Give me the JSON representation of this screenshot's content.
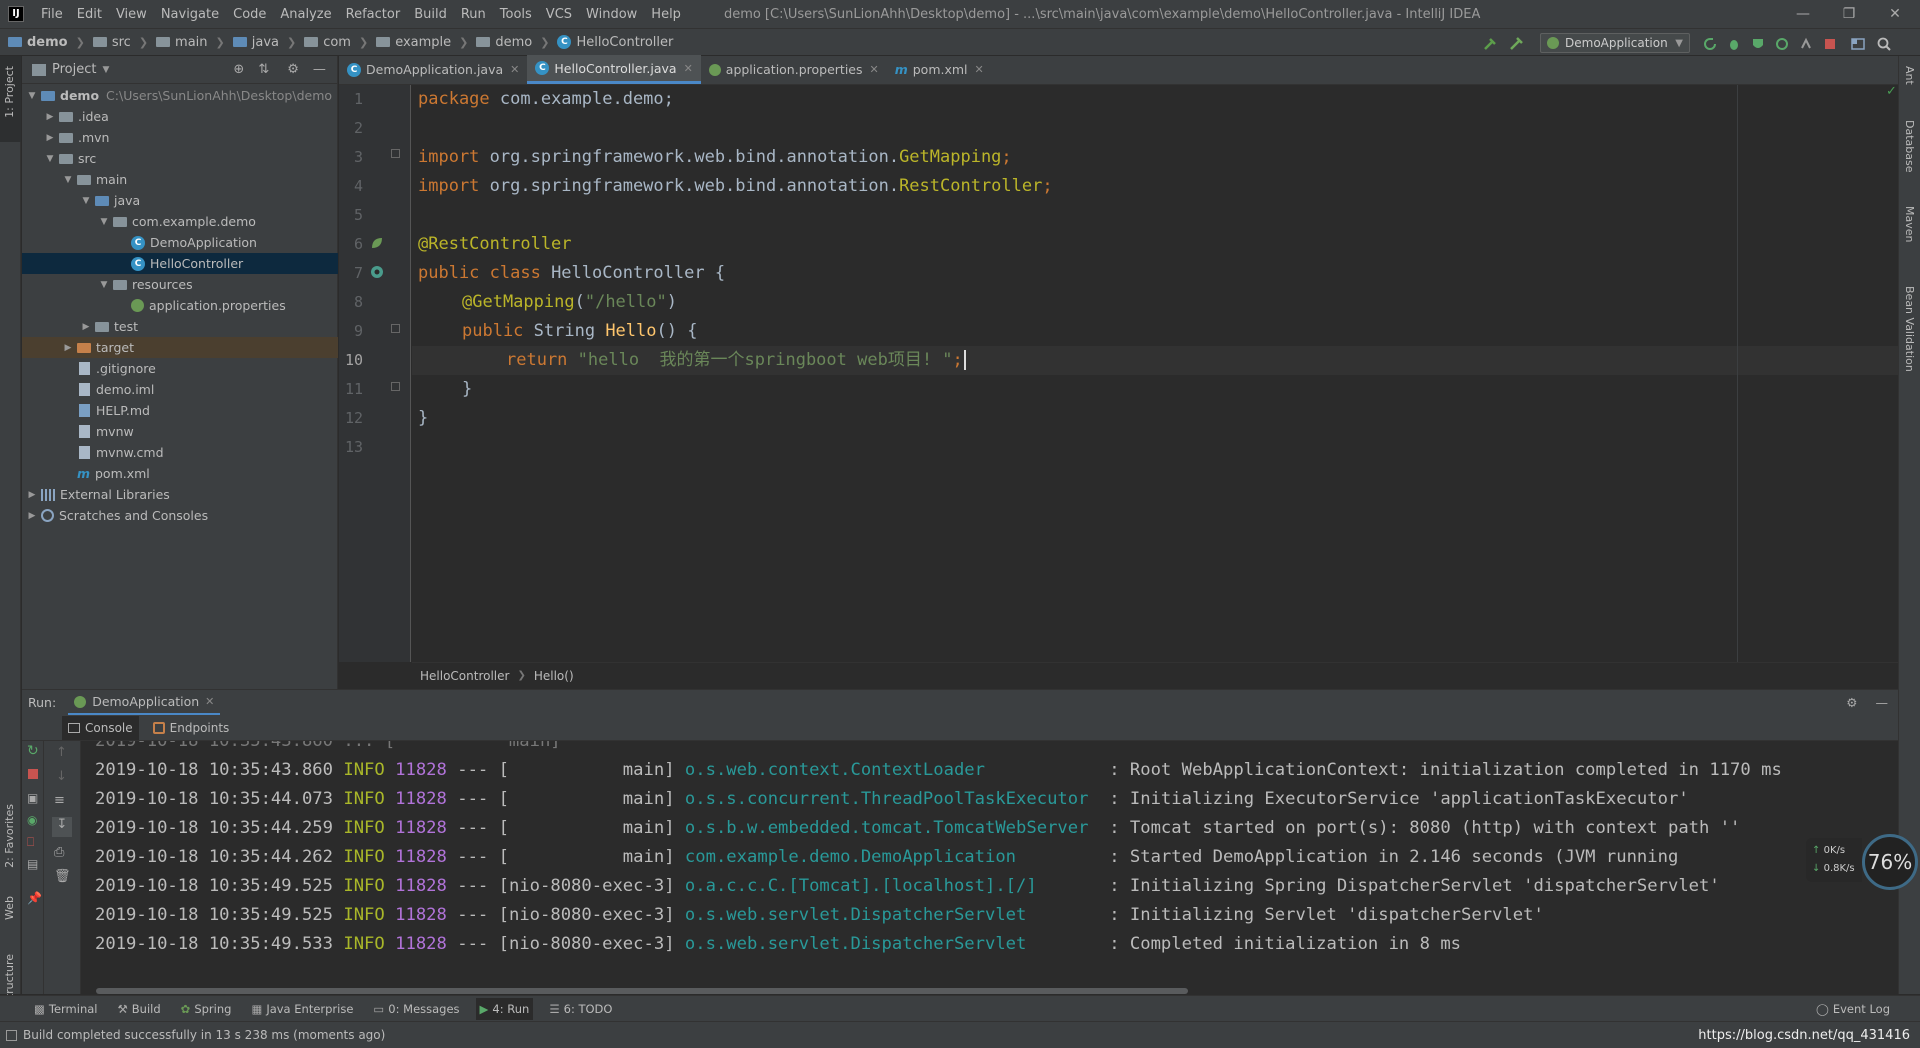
{
  "app": {
    "window_title": "demo [C:\\Users\\SunLionAhh\\Desktop\\demo] - ...\\src\\main\\java\\com\\example\\demo\\HelloController.java - IntelliJ IDEA",
    "logo": "IJ"
  },
  "menu": [
    "File",
    "Edit",
    "View",
    "Navigate",
    "Code",
    "Analyze",
    "Refactor",
    "Build",
    "Run",
    "Tools",
    "VCS",
    "Window",
    "Help"
  ],
  "breadcrumb": [
    "demo",
    "src",
    "main",
    "java",
    "com",
    "example",
    "demo",
    "HelloController"
  ],
  "toolbar": {
    "run_config": "DemoApplication"
  },
  "left_strip": {
    "project": "1: Project",
    "favorites": "2: Favorites",
    "web": "Web",
    "structure": "Z: Structure"
  },
  "right_strip": {
    "ant": "Ant",
    "database": "Database",
    "maven": "Maven",
    "bean": "Bean Validation"
  },
  "project": {
    "header": "Project",
    "tree": [
      {
        "label": "demo",
        "note": "C:\\Users\\SunLionAhh\\Desktop\\demo"
      },
      {
        "label": ".idea"
      },
      {
        "label": ".mvn"
      },
      {
        "label": "src"
      },
      {
        "label": "main"
      },
      {
        "label": "java"
      },
      {
        "label": "com.example.demo"
      },
      {
        "label": "DemoApplication"
      },
      {
        "label": "HelloController"
      },
      {
        "label": "resources"
      },
      {
        "label": "application.properties"
      },
      {
        "label": "test"
      },
      {
        "label": "target"
      },
      {
        "label": ".gitignore"
      },
      {
        "label": "demo.iml"
      },
      {
        "label": "HELP.md"
      },
      {
        "label": "mvnw"
      },
      {
        "label": "mvnw.cmd"
      },
      {
        "label": "pom.xml"
      },
      {
        "label": "External Libraries"
      },
      {
        "label": "Scratches and Consoles"
      }
    ]
  },
  "editor": {
    "tabs": [
      "DemoApplication.java",
      "HelloController.java",
      "application.properties",
      "pom.xml"
    ],
    "line_numbers": [
      "1",
      "2",
      "3",
      "4",
      "5",
      "6",
      "7",
      "8",
      "9",
      "10",
      "11",
      "12",
      "13"
    ],
    "code": {
      "l1_kw": "package ",
      "l1_rest": "com.example.demo;",
      "l3_kw": "import ",
      "l3_rest": "org.springframework.web.bind.annotation.",
      "l3_ann": "GetMapping",
      "l3_end": ";",
      "l4_kw": "import ",
      "l4_rest": "org.springframework.web.bind.annotation.",
      "l4_ann": "RestController",
      "l4_end": ";",
      "l6_ann": "@RestController",
      "l7_kw": "public class ",
      "l7_rest": "HelloController {",
      "l8_ann": "@GetMapping",
      "l8_p1": "(",
      "l8_str": "\"/hello\"",
      "l8_p2": ")",
      "l9_kw": "public ",
      "l9_type": "String ",
      "l9_fn": "Hello",
      "l9_rest": "() {",
      "l10_kw": "return ",
      "l10_str": "\"hello  我的第一个springboot web项目! \"",
      "l10_end": ";",
      "l11": "}",
      "l12": "}"
    },
    "crumb": [
      "HelloController",
      "Hello()"
    ]
  },
  "run": {
    "label": "Run:",
    "config": "DemoApplication",
    "tabs": [
      "Console",
      "Endpoints"
    ],
    "log": [
      {
        "ts": "2019-10-18 10:35:43.860",
        "lv": "INFO",
        "pid": "11828",
        "thr": "--- [           main]",
        "cls": "o.s.web.context.ContextLoader           ",
        "msg": ": Root WebApplicationContext: initialization completed in 1170 ms"
      },
      {
        "ts": "2019-10-18 10:35:44.073",
        "lv": "INFO",
        "pid": "11828",
        "thr": "--- [           main]",
        "cls": "o.s.s.concurrent.ThreadPoolTaskExecutor ",
        "msg": ": Initializing ExecutorService 'applicationTaskExecutor'"
      },
      {
        "ts": "2019-10-18 10:35:44.259",
        "lv": "INFO",
        "pid": "11828",
        "thr": "--- [           main]",
        "cls": "o.s.b.w.embedded.tomcat.TomcatWebServer ",
        "msg": ": Tomcat started on port(s): 8080 (http) with context path ''"
      },
      {
        "ts": "2019-10-18 10:35:44.262",
        "lv": "INFO",
        "pid": "11828",
        "thr": "--- [           main]",
        "cls": "com.example.demo.DemoApplication        ",
        "msg": ": Started DemoApplication in 2.146 seconds (JVM running"
      },
      {
        "ts": "2019-10-18 10:35:49.525",
        "lv": "INFO",
        "pid": "11828",
        "thr": "--- [nio-8080-exec-3]",
        "cls": "o.a.c.c.C.[Tomcat].[localhost].[/]      ",
        "msg": ": Initializing Spring DispatcherServlet 'dispatcherServlet'"
      },
      {
        "ts": "2019-10-18 10:35:49.525",
        "lv": "INFO",
        "pid": "11828",
        "thr": "--- [nio-8080-exec-3]",
        "cls": "o.s.web.servlet.DispatcherServlet       ",
        "msg": ": Initializing Servlet 'dispatcherServlet'"
      },
      {
        "ts": "2019-10-18 10:35:49.533",
        "lv": "INFO",
        "pid": "11828",
        "thr": "--- [nio-8080-exec-3]",
        "cls": "o.s.web.servlet.DispatcherServlet       ",
        "msg": ": Completed initialization in 8 ms"
      }
    ]
  },
  "bottom_tabs": [
    "Terminal",
    "Build",
    "Spring",
    "Java Enterprise",
    "0: Messages",
    "4: Run",
    "6: TODO"
  ],
  "event_log": "Event Log",
  "status": {
    "message": "Build completed successfully in 13 s 238 ms (moments ago)",
    "watermark": "https://blog.csdn.net/qq_431416"
  },
  "monitor": {
    "percent": "76%",
    "up": "0K/s",
    "down": "0.8K/s"
  },
  "colors": {
    "accent": "#4a88c7",
    "keyword": "#cc7832",
    "string": "#6a8759",
    "annotation": "#bbb529"
  }
}
